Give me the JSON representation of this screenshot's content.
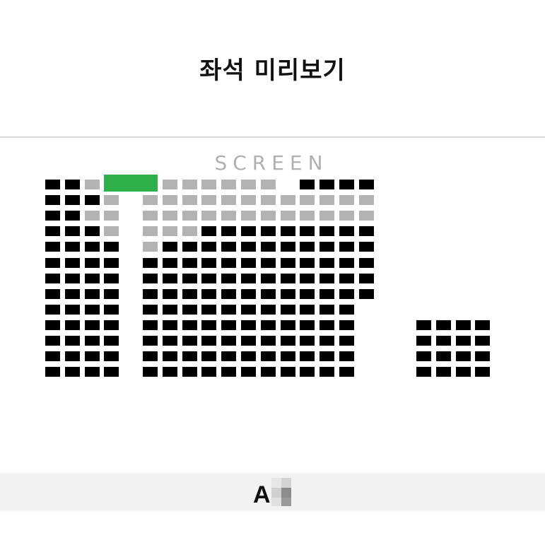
{
  "header": {
    "title": "좌석 미리보기"
  },
  "screen_label": "SCREEN",
  "colors": {
    "taken": "#000000",
    "available": "#b3b3b3",
    "selected": "#2db04a"
  },
  "seat_map": {
    "rows": [
      {
        "row": 1,
        "left": [
          "taken",
          "taken",
          "available",
          "selected"
        ],
        "center": [
          "selected",
          "available",
          "available",
          "available",
          "available",
          "available",
          "available",
          "empty",
          "taken",
          "taken",
          "taken",
          "taken"
        ],
        "right": []
      },
      {
        "row": 2,
        "left": [
          "taken",
          "taken",
          "taken",
          "available"
        ],
        "center": [
          "available",
          "available",
          "available",
          "available",
          "available",
          "available",
          "available",
          "available",
          "available",
          "available",
          "available",
          "available"
        ],
        "right": []
      },
      {
        "row": 3,
        "left": [
          "taken",
          "taken",
          "available",
          "available"
        ],
        "center": [
          "available",
          "available",
          "available",
          "available",
          "available",
          "available",
          "available",
          "available",
          "available",
          "available",
          "available",
          "available"
        ],
        "right": []
      },
      {
        "row": 4,
        "left": [
          "taken",
          "taken",
          "taken",
          "available"
        ],
        "center": [
          "available",
          "available",
          "available",
          "taken",
          "taken",
          "taken",
          "taken",
          "taken",
          "taken",
          "taken",
          "taken",
          "taken"
        ],
        "right": []
      },
      {
        "row": 5,
        "left": [
          "taken",
          "taken",
          "taken",
          "taken"
        ],
        "center": [
          "available",
          "taken",
          "taken",
          "taken",
          "taken",
          "taken",
          "taken",
          "taken",
          "taken",
          "taken",
          "taken",
          "taken"
        ],
        "right": []
      },
      {
        "row": 6,
        "left": [
          "taken",
          "taken",
          "taken",
          "taken"
        ],
        "center": [
          "taken",
          "taken",
          "taken",
          "taken",
          "taken",
          "taken",
          "taken",
          "taken",
          "taken",
          "taken",
          "taken",
          "taken"
        ],
        "right": []
      },
      {
        "row": 7,
        "left": [
          "taken",
          "taken",
          "taken",
          "taken"
        ],
        "center": [
          "taken",
          "taken",
          "taken",
          "taken",
          "taken",
          "taken",
          "taken",
          "taken",
          "taken",
          "taken",
          "taken",
          "taken"
        ],
        "right": []
      },
      {
        "row": 8,
        "left": [
          "taken",
          "taken",
          "taken",
          "taken"
        ],
        "center": [
          "taken",
          "taken",
          "taken",
          "taken",
          "taken",
          "taken",
          "taken",
          "taken",
          "taken",
          "taken",
          "taken",
          "taken"
        ],
        "right": []
      },
      {
        "row": 9,
        "left": [
          "taken",
          "taken",
          "taken",
          "taken"
        ],
        "center": [
          "taken",
          "taken",
          "taken",
          "taken",
          "taken",
          "taken",
          "taken",
          "taken",
          "taken",
          "taken",
          "taken"
        ],
        "right": []
      },
      {
        "row": 10,
        "left": [
          "taken",
          "taken",
          "taken",
          "taken"
        ],
        "center": [
          "taken",
          "taken",
          "taken",
          "taken",
          "taken",
          "taken",
          "taken",
          "taken",
          "taken",
          "taken",
          "taken"
        ],
        "right": [
          "taken",
          "taken",
          "taken",
          "taken"
        ]
      },
      {
        "row": 11,
        "left": [
          "taken",
          "taken",
          "taken",
          "taken"
        ],
        "center": [
          "taken",
          "taken",
          "taken",
          "taken",
          "taken",
          "taken",
          "taken",
          "taken",
          "taken",
          "taken",
          "taken"
        ],
        "right": [
          "taken",
          "taken",
          "taken",
          "taken"
        ]
      },
      {
        "row": 12,
        "left": [
          "taken",
          "taken",
          "taken",
          "taken"
        ],
        "center": [
          "taken",
          "taken",
          "taken",
          "taken",
          "taken",
          "taken",
          "taken",
          "taken",
          "taken",
          "taken",
          "taken"
        ],
        "right": [
          "taken",
          "taken",
          "taken",
          "taken"
        ]
      },
      {
        "row": 13,
        "left": [
          "taken",
          "taken",
          "taken",
          "taken"
        ],
        "center": [
          "taken",
          "taken",
          "taken",
          "taken",
          "taken",
          "taken",
          "taken",
          "taken",
          "taken",
          "taken",
          "taken"
        ],
        "right": [
          "taken",
          "taken",
          "taken",
          "taken"
        ]
      }
    ]
  },
  "footer": {
    "seat_code": "A"
  }
}
